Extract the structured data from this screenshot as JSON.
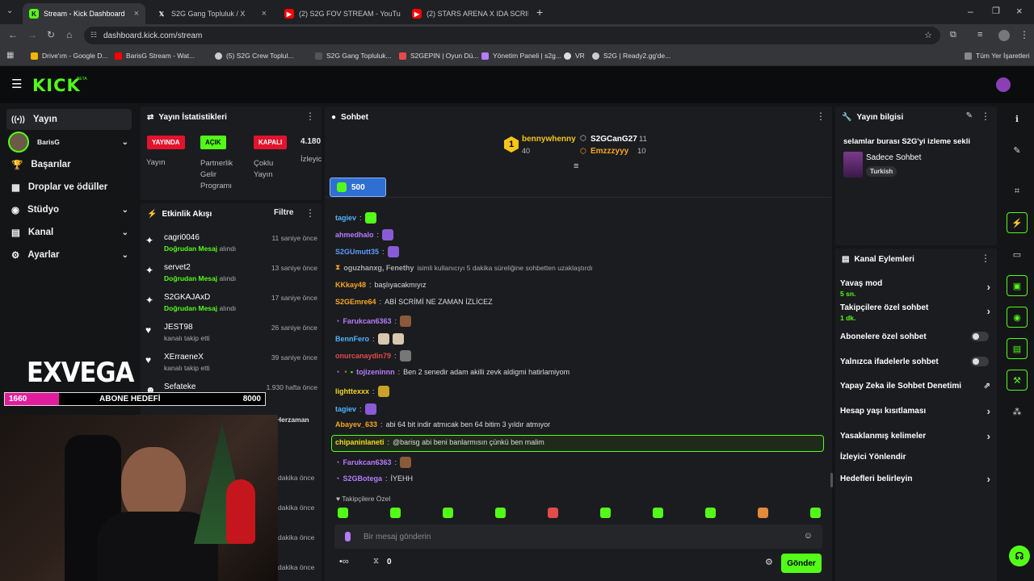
{
  "browser": {
    "tabs": [
      {
        "title": "Stream - Kick Dashboard",
        "active": true
      },
      {
        "title": "S2G Gang Topluluk / X"
      },
      {
        "title": "(2) S2G FOV STREAM - YouTube"
      },
      {
        "title": "(2) STARS ARENA X IDA SCRIM"
      }
    ],
    "url": "dashboard.kick.com/stream",
    "bookmarks": [
      "Drive'ım - Google D...",
      "BarisG Stream - Wat...",
      "(5) S2G Crew Toplul...",
      "S2G Gang Topluluk...",
      "S2GEPIN | Oyun Dü...",
      "Yönetim Paneli | s2g...",
      "VR",
      "S2G | Ready2.gg'de..."
    ],
    "all_bookmarks": "Tüm Yer İşaretleri"
  },
  "brand": {
    "logo": "KICK",
    "beta": "BETA",
    "accent": "#53fc18"
  },
  "nav": {
    "items": [
      {
        "label": "Yayın"
      },
      {
        "label": "BarisG"
      },
      {
        "label": "Başarılar"
      },
      {
        "label": "Droplar ve ödüller"
      },
      {
        "label": "Stüdyo"
      },
      {
        "label": "Kanal"
      },
      {
        "label": "Ayarlar"
      }
    ]
  },
  "stats": {
    "title": "Yayın İstatistikleri",
    "badges": [
      "YAYINDA",
      "AÇIK",
      "KAPALI"
    ],
    "labels": [
      "Yayın",
      "Partnerlik Gelir Programı",
      "Çoklu Yayın"
    ],
    "viewers": "4.180",
    "viewers_label": "İzleyic"
  },
  "activity": {
    "title": "Etkinlik Akışı",
    "filter": "Filtre",
    "items": [
      {
        "name": "cagri0046",
        "sub_b": "Doğrudan Mesaj",
        "sub": "alındı",
        "time": "11 saniye önce"
      },
      {
        "name": "servet2",
        "sub_b": "Doğrudan Mesaj",
        "sub": "alındı",
        "time": "13 saniye önce"
      },
      {
        "name": "S2GKAJAxD",
        "sub_b": "Doğrudan Mesaj",
        "sub": "alındı",
        "time": "17 saniye önce"
      },
      {
        "name": "JEST98",
        "sub_b": "",
        "sub": "kanalı takip etti",
        "time": "26 saniye önce"
      },
      {
        "name": "XErraeneX",
        "sub_b": "",
        "sub": "kanalı takip etti",
        "time": "39 saniye önce"
      },
      {
        "name": "Sefateke",
        "sub_b": "Rage Quit",
        "sub": "",
        "time": "1.930 hafta önce"
      }
    ],
    "extra_times": [
      "Herzaman",
      "dakika önce",
      "dakika önce",
      "dakika önce",
      "dakika önce"
    ]
  },
  "overlay": {
    "brand": "EXVEGA",
    "goal_current": "1660",
    "goal_label": "ABONE HEDEFİ",
    "goal_target": "8000",
    "goal_progress": 0.2075
  },
  "chat": {
    "title": "Sohbet",
    "leaders": [
      {
        "name": "bennywhenny",
        "score": "40",
        "rank": "1"
      },
      {
        "name": "S2GCanG27",
        "score": "11"
      },
      {
        "name": "Emzzzyyy",
        "score": "10"
      }
    ],
    "goal": "500",
    "messages": [
      {
        "user": "tagiev",
        "text": "",
        "color": "#4fb3ff",
        "emote": "#53fc18"
      },
      {
        "user": "ahmedhalo",
        "text": "",
        "color": "#b57cff",
        "emote": "#8a5bd6"
      },
      {
        "user": "S2GUmutt35",
        "text": "",
        "color": "#5b9bff",
        "emote": "#8a5bd6"
      },
      {
        "user": "oguzhanxg, Fenethy",
        "text": "isimli kullanıcıyı 5 dakika süreliğine sohbetten uzaklaştırdı",
        "color": "#aaaaaa",
        "system": true
      },
      {
        "user": "KKkay48",
        "text": "başlıyacakmıyız",
        "color": "#f5a623"
      },
      {
        "user": "S2GEmre64",
        "text": "ABİ SCRİMİ NE ZAMAN İZLİCEZ",
        "color": "#f5a623"
      },
      {
        "user": "Farukcan6363",
        "text": "",
        "color": "#b57cff",
        "emote": "#8a5a3a"
      },
      {
        "user": "BennFero",
        "text": "",
        "color": "#4fb3ff",
        "emote": "#d9c7b0"
      },
      {
        "user": "onurcanaydin79",
        "text": "",
        "color": "#e34b4b",
        "emote": "#777777"
      },
      {
        "user": "tojizeninnn",
        "text": "Ben 2 senedir adam akilli zevk aldigmi hatirlamiyom",
        "color": "#b57cff"
      },
      {
        "user": "lighttexxx",
        "text": "",
        "color": "#f5d623",
        "emote": "#c9a227"
      },
      {
        "user": "tagiev",
        "text": "",
        "color": "#4fb3ff",
        "emote": "#8a5bd6"
      },
      {
        "user": "Abayev_633",
        "text": "abi 64 bit indir atmıcak ben 64 bitim 3 yıldır atmıyor",
        "color": "#f5a623"
      },
      {
        "user": "chipaninlaneti",
        "text": "@barisg abi beni banlarmısın çünkü ben malim",
        "color": "#f5d623",
        "highlight": true
      },
      {
        "user": "Farukcan6363",
        "text": "",
        "color": "#b57cff",
        "emote": "#8a5a3a"
      },
      {
        "user": "S2GBotega",
        "text": "İYEHH",
        "color": "#b57cff"
      }
    ],
    "followers_only": "Takipçilere Özel",
    "placeholder": "Bir mesaj gönderin",
    "count": "0",
    "send": "Gönder"
  },
  "stream_info": {
    "title": "Yayın bilgisi",
    "stream_title": "selamlar burası S2G'yi izleme sekli",
    "category": "Sadece Sohbet",
    "language": "Turkish"
  },
  "channel_actions": {
    "title": "Kanal Eylemleri",
    "items": [
      {
        "label": "Yavaş mod",
        "sub": "5 sn.",
        "control": "arrow"
      },
      {
        "label": "Takipçilere özel sohbet",
        "sub": "1 dk.",
        "control": "arrow"
      },
      {
        "label": "Abonelere özel sohbet",
        "sub": "",
        "control": "toggle"
      },
      {
        "label": "Yalnızca ifadelerle sohbet",
        "sub": "",
        "control": "toggle"
      },
      {
        "label": "Yapay Zeka ile Sohbet Denetimi",
        "sub": "",
        "control": "external"
      },
      {
        "label": "Hesap yaşı kısıtlaması",
        "sub": "",
        "control": "arrow"
      },
      {
        "label": "Yasaklanmış kelimeler",
        "sub": "",
        "control": "arrow"
      },
      {
        "label": "İzleyici Yönlendir",
        "sub": "",
        "control": "none"
      },
      {
        "label": "Hedefleri belirleyin",
        "sub": "",
        "control": "arrow"
      }
    ]
  }
}
